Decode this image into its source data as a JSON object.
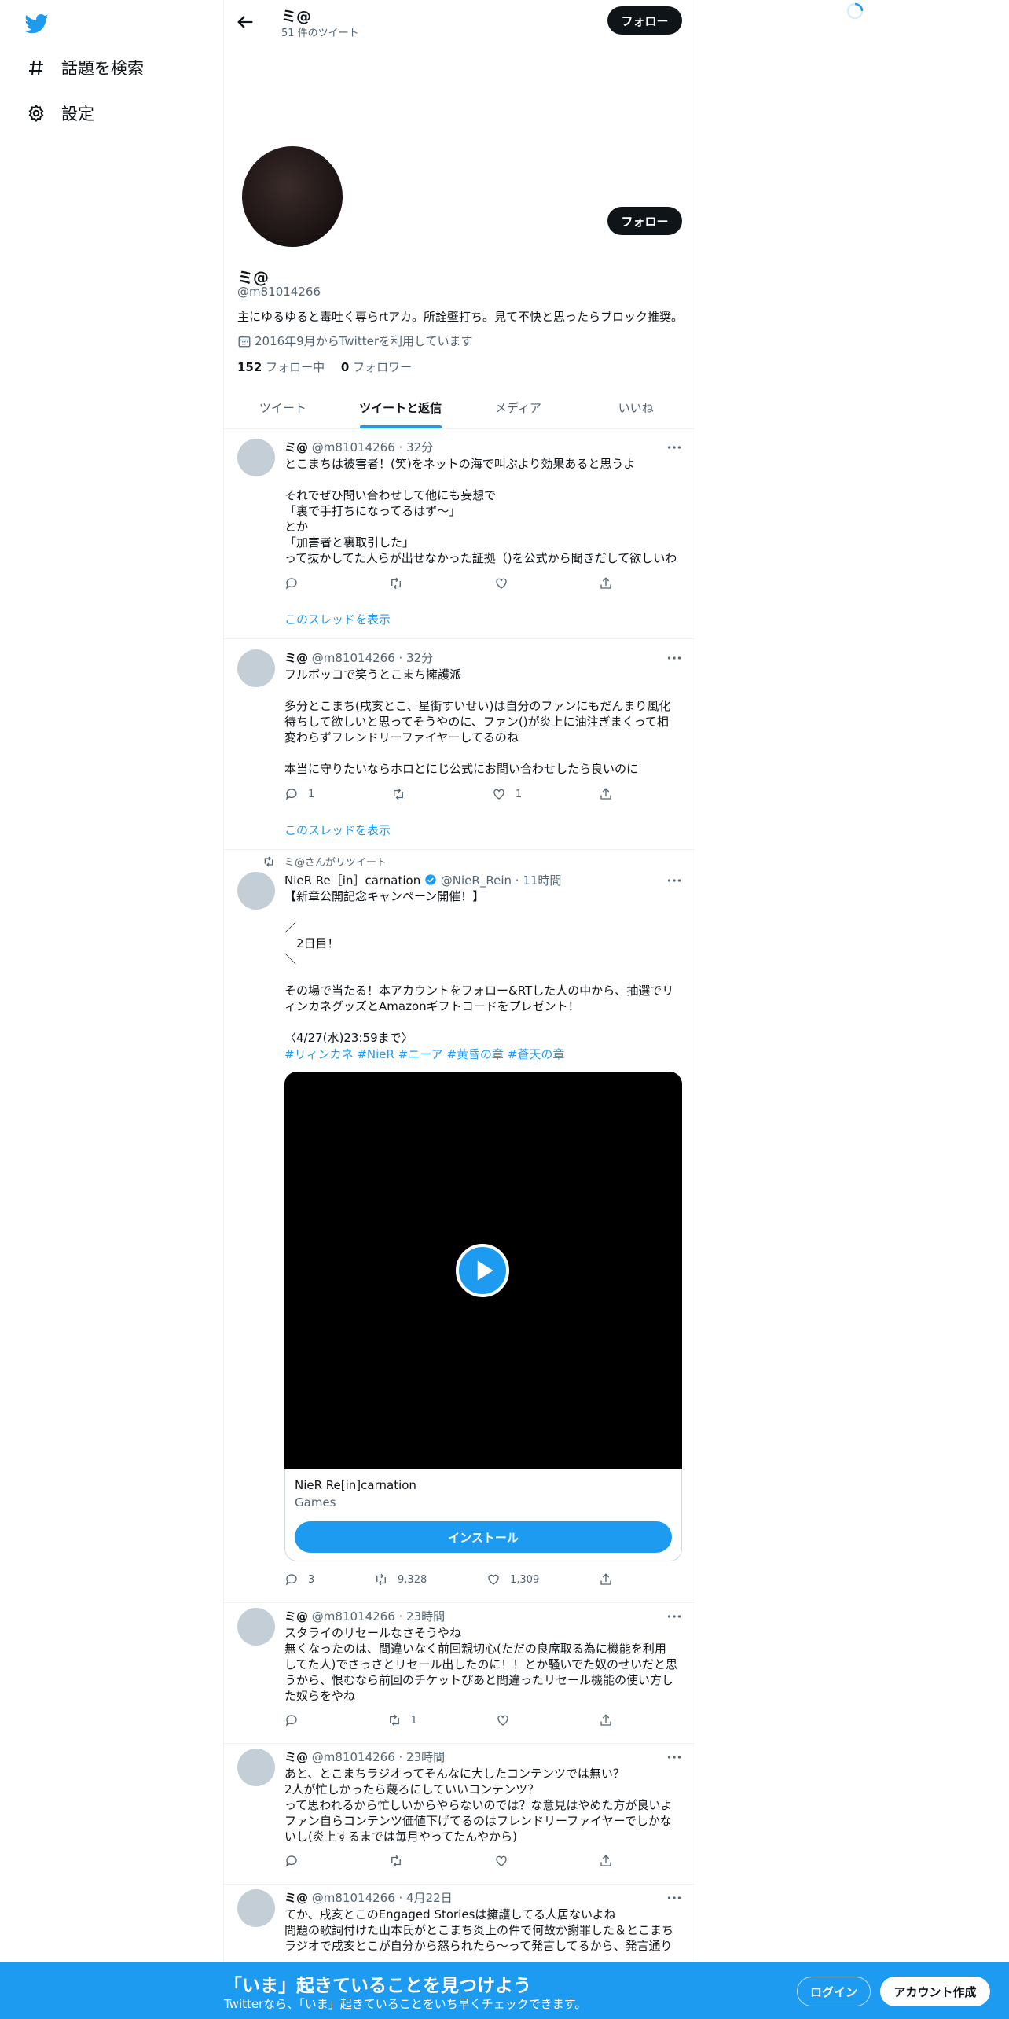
{
  "nav": {
    "search_label": "話題を検索",
    "settings_label": "設定"
  },
  "header": {
    "title": "ミ@",
    "subtitle": "51 件のツイート",
    "follow_label": "フォロー"
  },
  "profile": {
    "name": "ミ@",
    "handle": "@m81014266",
    "bio": "主にゆるゆると毒吐く専らrtアカ。所詮壁打ち。見て不快と思ったらブロック推奨。",
    "joined": "2016年9月からTwitterを利用しています",
    "following_count": "152",
    "following_label": "フォロー中",
    "followers_count": "0",
    "followers_label": "フォロワー",
    "follow_label": "フォロー"
  },
  "tabs": [
    "ツイート",
    "ツイートと返信",
    "メディア",
    "いいね"
  ],
  "tweets": [
    {
      "name": "ミ@",
      "meta": "@m81014266 · 32分",
      "text": "とこまちは被害者！(笑)をネットの海で叫ぶより効果あると思うよ\n\nそれでぜひ問い合わせして他にも妄想で\n「裏で手打ちになってるはず〜」\nとか\n「加害者と裏取引した」\nって抜かしてた人らが出せなかった証拠（)を公式から聞きだして欲しいわ",
      "reply": "",
      "retweet": "",
      "like": "",
      "thread": "このスレッドを表示"
    },
    {
      "name": "ミ@",
      "meta": "@m81014266 · 32分",
      "text": "フルボッコで笑うとこまち擁護派\n\n多分とこまち(戌亥とこ、星街すいせい)は自分のファンにもだんまり風化待ちして欲しいと思ってそうやのに、ファン()が炎上に油注ぎまくって相変わらずフレンドリーファイヤーしてるのね\n\n本当に守りたいならホロとにじ公式にお問い合わせしたら良いのに",
      "reply": "1",
      "retweet": "",
      "like": "1",
      "thread": "このスレッドを表示"
    },
    {
      "retweeted_by": "ミ@さんがリツイート",
      "name": "NieR Re［in］carnation",
      "meta": "@NieR_Rein · 11時間",
      "text": "【新章公開記念キャンペーン開催！】\n\n／\n　2日目！\n＼\n\nその場で当たる！本アカウントをフォロー&RTした人の中から、抽選でリィンカネグッズとAmazonギフトコードをプレゼント！\n\n〈4/27(水)23:59まで〉",
      "hashtags": "#リィンカネ #NieR #ニーア #黄昏の章 #蒼天の章",
      "card_app": "NieR Re[in]carnation",
      "card_category": "Games",
      "card_button": "インストール",
      "reply": "3",
      "retweet": "9,328",
      "like": "1,309"
    },
    {
      "name": "ミ@",
      "meta": "@m81014266 · 23時間",
      "text": "スタライのリセールなさそうやね\n無くなったのは、間違いなく前回親切心(ただの良席取る為に機能を利用してた人)でさっさとリセール出したのに！！とか騒いでた奴のせいだと思うから、恨むなら前回のチケットぴあと間違ったリセール機能の使い方した奴らをやね",
      "reply": "",
      "retweet": "1",
      "like": ""
    },
    {
      "name": "ミ@",
      "meta": "@m81014266 · 23時間",
      "text": "あと、とこまちラジオってそんなに大したコンテンツでは無い？\n2人が忙しかったら蔑ろにしていいコンテンツ？\nって思われるから忙しいからやらないのでは？な意見はやめた方が良いよファン自らコンテンツ価値下げてるのはフレンドリーファイヤーでしかないし(炎上するまでは毎月やってたんやから)",
      "reply": "",
      "retweet": "",
      "like": ""
    },
    {
      "name": "ミ@",
      "meta": "@m81014266 · 4月22日",
      "text": "てか、戌亥とこのEngaged Storiesは擁護してる人居ないよね\n問題の歌詞付けた山本氏がとこまち炎上の件で何故か謝罪した＆とこまちラジオで戌亥とこが自分から怒られたら〜って発言してるから、発言通り"
    }
  ],
  "banner": {
    "title": "「いま」起きていることを見つけよう",
    "subtitle": "Twitterなら、「いま」起きていることをいち早くチェックできます。",
    "login": "ログイン",
    "signup": "アカウント作成"
  }
}
